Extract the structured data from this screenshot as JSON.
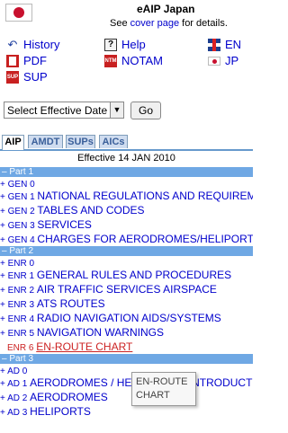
{
  "header": {
    "title": "eAIP Japan",
    "cover_prefix": "See ",
    "cover_link": "cover page",
    "cover_suffix": " for details."
  },
  "nav": {
    "history": "History",
    "help": "Help",
    "en": "EN",
    "pdf": "PDF",
    "notam": "NOTAM",
    "jp": "JP",
    "sup": "SUP",
    "notam_icon_text": "NTM",
    "sup_icon_text": "SUP",
    "help_icon_text": "?"
  },
  "controls": {
    "date_select": "Select Effective Date",
    "go": "Go"
  },
  "tabs": [
    "AIP",
    "AMDT",
    "SUPs",
    "AICs"
  ],
  "effective_date": "Effective 14 JAN 2010",
  "parts": [
    {
      "header": "– Part 1",
      "items": [
        {
          "code": "+ GEN 0",
          "title": ""
        },
        {
          "code": "+ GEN 1 ",
          "title": "NATIONAL REGULATIONS AND REQUIREMENTS"
        },
        {
          "code": "+ GEN 2 ",
          "title": "TABLES AND CODES"
        },
        {
          "code": "+ GEN 3 ",
          "title": "SERVICES"
        },
        {
          "code": "+ GEN 4 ",
          "title": "CHARGES FOR AERODROMES/HELIPORTS"
        }
      ]
    },
    {
      "header": "– Part 2",
      "items": [
        {
          "code": "+ ENR 0",
          "title": ""
        },
        {
          "code": "+ ENR 1 ",
          "title": "GENERAL RULES AND PROCEDURES"
        },
        {
          "code": "+ ENR 2 ",
          "title": "AIR TRAFFIC SERVICES AIRSPACE"
        },
        {
          "code": "+ ENR 3 ",
          "title": "ATS ROUTES"
        },
        {
          "code": "+ ENR 4 ",
          "title": "RADIO NAVIGATION AIDS/SYSTEMS"
        },
        {
          "code": "+ ENR 5 ",
          "title": "NAVIGATION WARNINGS"
        },
        {
          "code": "ENR 6 ",
          "title": "EN-ROUTE CHART"
        }
      ]
    },
    {
      "header": "– Part 3",
      "items": [
        {
          "code": "+ AD 0",
          "title": ""
        },
        {
          "code": "+ AD 1 ",
          "title": "AERODROMES / HELICOPTER INTRODUCTION"
        },
        {
          "code": "+ AD 2 ",
          "title": "AERODROMES"
        },
        {
          "code": "+ AD 3 ",
          "title": "HELIPORTS"
        }
      ]
    }
  ],
  "tooltip": "EN-ROUTE CHART"
}
